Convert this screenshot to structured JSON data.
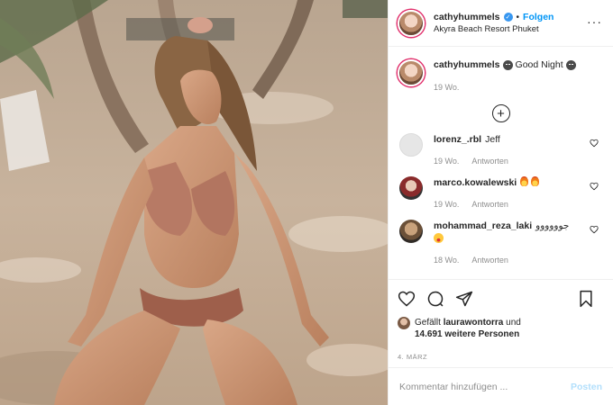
{
  "header": {
    "username": "cathyhummels",
    "verified_glyph": "✓",
    "separator": "•",
    "follow_label": "Folgen",
    "location": "Akyra Beach Resort Phuket",
    "more_glyph": "···"
  },
  "caption": {
    "username": "cathyhummels",
    "text": "Good Night",
    "time": "19 Wo."
  },
  "load_more_glyph": "+",
  "comments": [
    {
      "username": "lorenz_.rbl",
      "text": "Jeff",
      "time": "19 Wo.",
      "reply": "Antworten"
    },
    {
      "username": "marco.kowalewski",
      "text": "",
      "time": "19 Wo.",
      "reply": "Antworten"
    },
    {
      "username": "mohammad_reza_laki",
      "text": "جوووووو",
      "time": "18 Wo.",
      "reply": "Antworten"
    }
  ],
  "likes": {
    "prefix": "Gefällt",
    "user": "laurawontorra",
    "connector": "und",
    "count": "14.691 weitere Personen"
  },
  "date": "4. März",
  "add_comment": {
    "placeholder": "Kommentar hinzufügen ...",
    "post_label": "Posten"
  },
  "icons": {
    "like": "heart-icon",
    "comment": "speech-bubble-icon",
    "share": "paper-plane-icon",
    "save": "bookmark-icon"
  },
  "colors": {
    "link_blue": "#0095f6",
    "verified_blue": "#3897f0",
    "muted_gray": "#8e8e8e",
    "post_button_disabled": "#b2dffc"
  }
}
